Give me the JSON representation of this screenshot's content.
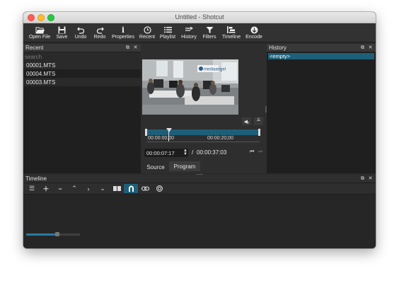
{
  "window": {
    "title": "Untitled - Shotcut"
  },
  "toolbar": {
    "items": [
      {
        "label": "Open File",
        "icon": "folder-open-icon"
      },
      {
        "label": "Save",
        "icon": "save-icon"
      },
      {
        "label": "Undo",
        "icon": "undo-icon"
      },
      {
        "label": "Redo",
        "icon": "redo-icon"
      },
      {
        "label": "Properties",
        "icon": "info-icon"
      },
      {
        "label": "Recent",
        "icon": "clock-icon"
      },
      {
        "label": "Playlist",
        "icon": "list-icon"
      },
      {
        "label": "History",
        "icon": "history-icon"
      },
      {
        "label": "Filters",
        "icon": "filter-icon"
      },
      {
        "label": "Timeline",
        "icon": "timeline-icon"
      },
      {
        "label": "Encode",
        "icon": "encode-icon"
      }
    ]
  },
  "recent": {
    "title": "Recent",
    "search_placeholder": "search",
    "files": [
      "00001.MTS",
      "00004.MTS",
      "00003.MTS"
    ]
  },
  "player": {
    "ruler_start": "00:00:00;00",
    "ruler_mid": "00:00:20;00",
    "current_time": "00:00:07:17",
    "separator": "/",
    "total_time": "00:00:37:03",
    "tabs": [
      "Source",
      "Program"
    ],
    "active_tab": "Program",
    "video_logo": "mediaangel"
  },
  "history": {
    "title": "History",
    "items": [
      "<empty>"
    ]
  },
  "timeline": {
    "title": "Timeline"
  },
  "colors": {
    "accent": "#1e5f78",
    "panel_bg": "#1f1f1f",
    "toolbar_bg": "#323232"
  }
}
